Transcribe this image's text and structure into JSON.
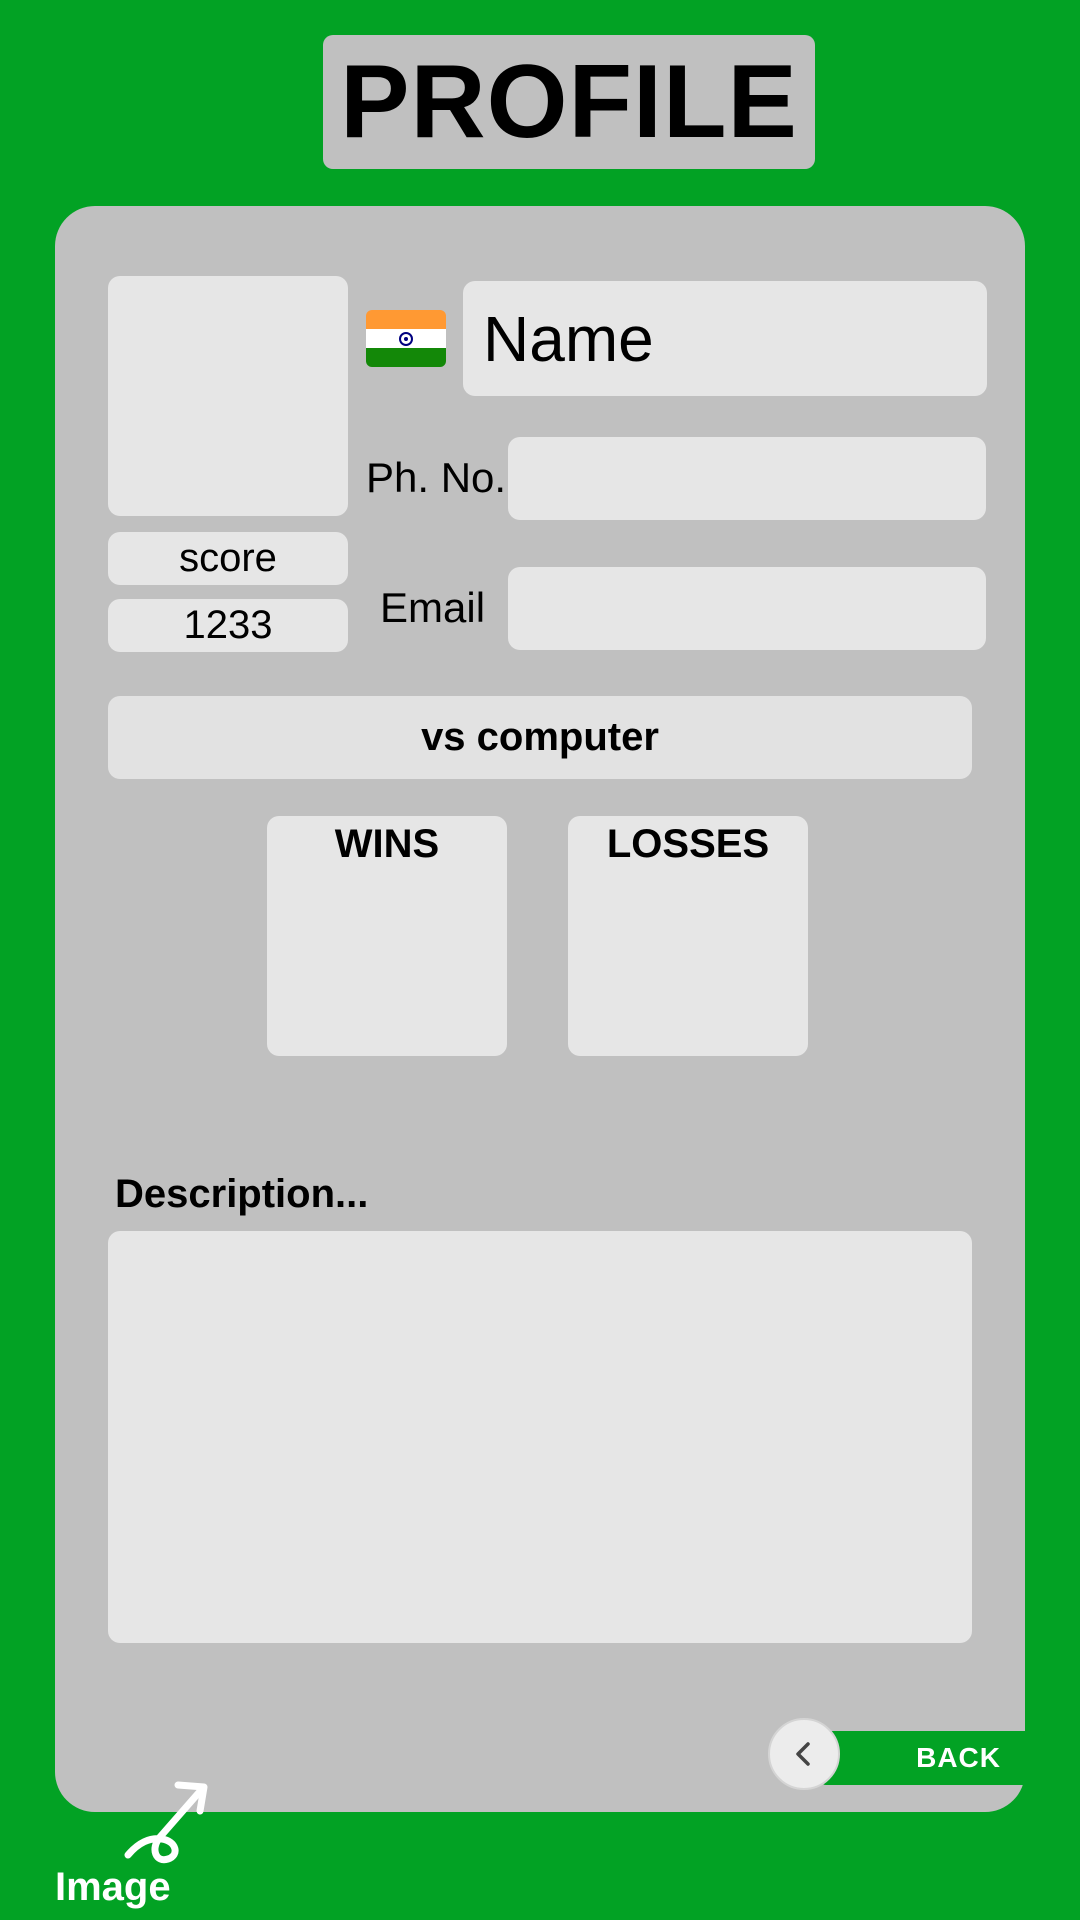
{
  "page": {
    "title": "PROFILE"
  },
  "profile": {
    "name_placeholder": "Name",
    "flag_icon": "india-flag-icon",
    "phone_label": "Ph. No.",
    "phone_value": "",
    "email_label": "Email",
    "email_value": "",
    "score_label": "score",
    "score_value": "1233"
  },
  "mode": {
    "label": "vs computer"
  },
  "stats": {
    "wins_label": "WINS",
    "losses_label": "LOSSES"
  },
  "description": {
    "label": "Description...",
    "value": ""
  },
  "footer": {
    "back_label": "BACK",
    "back_icon": "chevron-left-icon",
    "image_label": "Image",
    "image_icon": "image-arrow-icon"
  },
  "colors": {
    "background": "#02a224",
    "card": "#c0c0c0",
    "field": "#e6e6e6",
    "accent": "#02a224"
  }
}
